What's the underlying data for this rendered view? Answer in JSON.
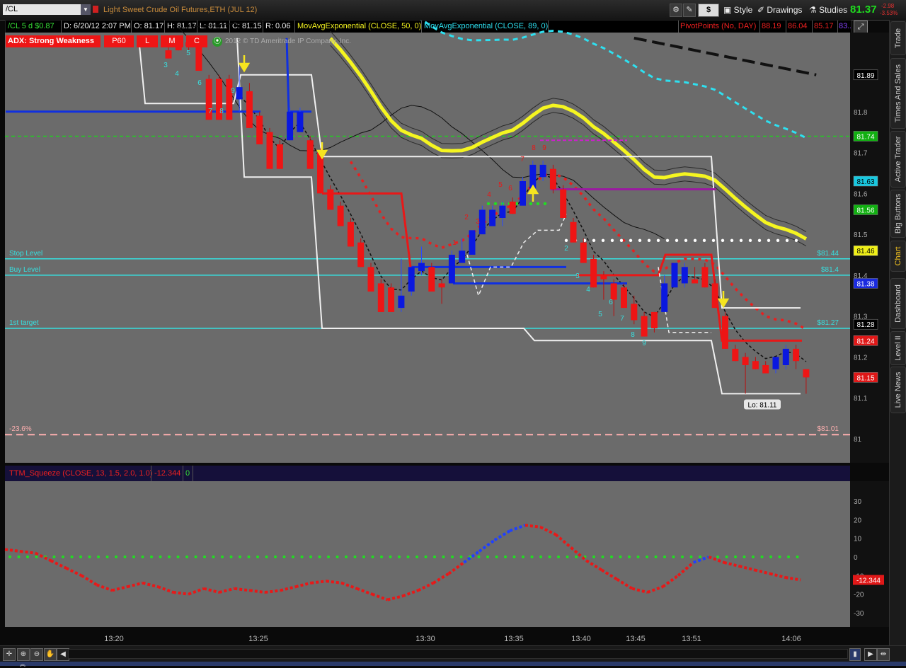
{
  "toolbar": {
    "symbol": "/CL",
    "title": "Light Sweet Crude Oil Futures,ETH (JUL 12)",
    "style_label": "Style",
    "drawings_label": "Drawings",
    "studies_label": "Studies",
    "dollar_label": "$",
    "last_price": "81.37",
    "change": "-2.98",
    "change_pct": "-3.53%"
  },
  "header": {
    "period": "/CL 5 d $0.87",
    "date": "D: 6/20/12 2:07 PM",
    "open": "O: 81.17",
    "high": "H: 81.17",
    "low": "L: 81.11",
    "close": "C: 81.15",
    "range": "R: 0.06",
    "ma50": "MovAvgExponential (CLOSE, 50, 0)",
    "ma89": "MovAvgExponential (CLOSE, 89, 0)",
    "pivot_label": "PivotPoints (No, DAY)",
    "pivot_values": [
      "88.19",
      "86.04",
      "85.17",
      "83..."
    ]
  },
  "badges": {
    "adx": "ADX:  Strong Weakness",
    "p60": "P60",
    "l": "L",
    "m": "M",
    "c": "C",
    "copyright": "2012 © TD Ameritrade IP Company, Inc."
  },
  "sidebar": {
    "tabs": [
      "Trade",
      "Times And Sales",
      "Active Trader",
      "Big Buttons",
      "Chart",
      "Dashboard",
      "Level II",
      "Live News"
    ],
    "active": "Chart"
  },
  "colors": {
    "up": "#0a18e0",
    "down": "#ee1515",
    "panel": "#6b6b6b",
    "ema50": "#f5f520",
    "ema89": "#2ee0f0",
    "level": "#36e0e0"
  },
  "chart_data": [
    {
      "type": "candlestick",
      "title": "",
      "ylim": [
        80.95,
        81.98
      ],
      "y_ticks": [
        81.0,
        81.1,
        81.2,
        81.3,
        81.4,
        81.5,
        81.6,
        81.7,
        81.8
      ],
      "x_ticks": [
        "13:20",
        "13:25",
        "13:30",
        "13:35",
        "13:40",
        "13:45",
        "13:51",
        "14:06"
      ],
      "y_tick_labels": [
        "81",
        "81.1",
        "81.2",
        "81.3",
        "81.4",
        "81.5",
        "81.6",
        "81.7",
        "81.8",
        "81.9"
      ],
      "candles": [
        {
          "o": 81.95,
          "h": 81.96,
          "l": 81.93,
          "c": 81.93
        },
        {
          "o": 81.96,
          "h": 81.97,
          "l": 81.95,
          "c": 81.95
        },
        {
          "o": 81.97,
          "h": 81.98,
          "l": 81.95,
          "c": 81.96
        },
        {
          "o": 81.97,
          "h": 81.98,
          "l": 81.9,
          "c": 81.9
        },
        {
          "o": 81.88,
          "h": 81.89,
          "l": 81.78,
          "c": 81.78
        },
        {
          "o": 81.88,
          "h": 81.89,
          "l": 81.78,
          "c": 81.78
        },
        {
          "o": 81.88,
          "h": 81.89,
          "l": 81.78,
          "c": 81.78
        },
        {
          "o": 81.83,
          "h": 81.91,
          "l": 81.8,
          "c": 81.86
        },
        {
          "o": 81.85,
          "h": 81.87,
          "l": 81.76,
          "c": 81.76
        },
        {
          "o": 81.79,
          "h": 81.8,
          "l": 81.72,
          "c": 81.72
        },
        {
          "o": 81.75,
          "h": 81.76,
          "l": 81.66,
          "c": 81.66
        },
        {
          "o": 81.72,
          "h": 81.73,
          "l": 81.66,
          "c": 81.66
        },
        {
          "o": 81.73,
          "h": 81.81,
          "l": 81.73,
          "c": 81.8
        },
        {
          "o": 81.75,
          "h": 81.81,
          "l": 81.75,
          "c": 81.8
        },
        {
          "o": 81.73,
          "h": 81.74,
          "l": 81.66,
          "c": 81.66
        },
        {
          "o": 81.7,
          "h": 81.71,
          "l": 81.6,
          "c": 81.6
        },
        {
          "o": 81.61,
          "h": 81.62,
          "l": 81.56,
          "c": 81.56
        },
        {
          "o": 81.57,
          "h": 81.58,
          "l": 81.52,
          "c": 81.52
        },
        {
          "o": 81.53,
          "h": 81.54,
          "l": 81.47,
          "c": 81.47
        },
        {
          "o": 81.48,
          "h": 81.49,
          "l": 81.42,
          "c": 81.42
        },
        {
          "o": 81.42,
          "h": 81.43,
          "l": 81.36,
          "c": 81.36
        },
        {
          "o": 81.38,
          "h": 81.39,
          "l": 81.31,
          "c": 81.31
        },
        {
          "o": 81.37,
          "h": 81.38,
          "l": 81.31,
          "c": 81.31
        },
        {
          "o": 81.32,
          "h": 81.44,
          "l": 81.31,
          "c": 81.35
        },
        {
          "o": 81.36,
          "h": 81.42,
          "l": 81.35,
          "c": 81.42
        },
        {
          "o": 81.41,
          "h": 81.47,
          "l": 81.4,
          "c": 81.43
        },
        {
          "o": 81.42,
          "h": 81.43,
          "l": 81.36,
          "c": 81.36
        },
        {
          "o": 81.38,
          "h": 81.39,
          "l": 81.33,
          "c": 81.37
        },
        {
          "o": 81.38,
          "h": 81.46,
          "l": 81.38,
          "c": 81.45
        },
        {
          "o": 81.43,
          "h": 81.49,
          "l": 81.43,
          "c": 81.46
        },
        {
          "o": 81.45,
          "h": 81.51,
          "l": 81.45,
          "c": 81.51
        },
        {
          "o": 81.5,
          "h": 81.57,
          "l": 81.5,
          "c": 81.56
        },
        {
          "o": 81.52,
          "h": 81.57,
          "l": 81.52,
          "c": 81.56
        },
        {
          "o": 81.54,
          "h": 81.58,
          "l": 81.52,
          "c": 81.57
        },
        {
          "o": 81.58,
          "h": 81.59,
          "l": 81.55,
          "c": 81.55
        },
        {
          "o": 81.57,
          "h": 81.64,
          "l": 81.57,
          "c": 81.63
        },
        {
          "o": 81.61,
          "h": 81.68,
          "l": 81.6,
          "c": 81.67
        },
        {
          "o": 81.64,
          "h": 81.68,
          "l": 81.63,
          "c": 81.67
        },
        {
          "o": 81.66,
          "h": 81.67,
          "l": 81.6,
          "c": 81.61
        },
        {
          "o": 81.61,
          "h": 81.62,
          "l": 81.54,
          "c": 81.54
        },
        {
          "o": 81.53,
          "h": 81.54,
          "l": 81.48,
          "c": 81.48
        },
        {
          "o": 81.48,
          "h": 81.49,
          "l": 81.43,
          "c": 81.43
        },
        {
          "o": 81.44,
          "h": 81.45,
          "l": 81.37,
          "c": 81.37
        },
        {
          "o": 81.4,
          "h": 81.41,
          "l": 81.34,
          "c": 81.39
        },
        {
          "o": 81.38,
          "h": 81.39,
          "l": 81.3,
          "c": 81.34
        },
        {
          "o": 81.37,
          "h": 81.38,
          "l": 81.32,
          "c": 81.32
        },
        {
          "o": 81.33,
          "h": 81.35,
          "l": 81.28,
          "c": 81.29
        },
        {
          "o": 81.3,
          "h": 81.31,
          "l": 81.25,
          "c": 81.25
        },
        {
          "o": 81.31,
          "h": 81.31,
          "l": 81.26,
          "c": 81.27
        },
        {
          "o": 81.31,
          "h": 81.4,
          "l": 81.31,
          "c": 81.38
        },
        {
          "o": 81.37,
          "h": 81.43,
          "l": 81.37,
          "c": 81.43
        },
        {
          "o": 81.38,
          "h": 81.43,
          "l": 81.37,
          "c": 81.42
        },
        {
          "o": 81.39,
          "h": 81.42,
          "l": 81.38,
          "c": 81.38
        },
        {
          "o": 81.42,
          "h": 81.43,
          "l": 81.37,
          "c": 81.37
        },
        {
          "o": 81.38,
          "h": 81.39,
          "l": 81.32,
          "c": 81.32
        },
        {
          "o": 81.3,
          "h": 81.31,
          "l": 81.22,
          "c": 81.22
        },
        {
          "o": 81.22,
          "h": 81.23,
          "l": 81.19,
          "c": 81.19
        },
        {
          "o": 81.2,
          "h": 81.21,
          "l": 81.11,
          "c": 81.18
        },
        {
          "o": 81.19,
          "h": 81.2,
          "l": 81.17,
          "c": 81.17
        },
        {
          "o": 81.18,
          "h": 81.19,
          "l": 81.16,
          "c": 81.16
        },
        {
          "o": 81.17,
          "h": 81.2,
          "l": 81.16,
          "c": 81.2
        },
        {
          "o": 81.18,
          "h": 81.23,
          "l": 81.17,
          "c": 81.22
        },
        {
          "o": 81.22,
          "h": 81.23,
          "l": 81.17,
          "c": 81.19
        },
        {
          "o": 81.17,
          "h": 81.17,
          "l": 81.11,
          "c": 81.15
        }
      ],
      "levels": [
        {
          "label": "Stop Level",
          "value": 81.44,
          "value_label": "$81.44",
          "color": "#36e0e0"
        },
        {
          "label": "Buy Level",
          "value": 81.4,
          "value_label": "$81.4",
          "color": "#36e0e0"
        },
        {
          "label": "1st target",
          "value": 81.27,
          "value_label": "$81.27",
          "color": "#36e0e0"
        },
        {
          "label": "-23.6%",
          "value": 81.01,
          "value_label": "$81.01",
          "color": "#ffb0b0"
        }
      ],
      "price_badges": [
        {
          "value": 81.89,
          "label": "81.89",
          "bg": "#000000",
          "fg": "#ffffff"
        },
        {
          "value": 81.74,
          "label": "81.74",
          "bg": "#11b011",
          "fg": "#ffffff"
        },
        {
          "value": 81.63,
          "label": "81.63",
          "bg": "#18c8e0",
          "fg": "#000000"
        },
        {
          "value": 81.56,
          "label": "81.56",
          "bg": "#11b011",
          "fg": "#ffffff"
        },
        {
          "value": 81.46,
          "label": "81.46",
          "bg": "#f0f018",
          "fg": "#000000"
        },
        {
          "value": 81.38,
          "label": "81.38",
          "bg": "#1a2ae0",
          "fg": "#ffffff"
        },
        {
          "value": 81.28,
          "label": "81.28",
          "bg": "#000000",
          "fg": "#ffffff"
        },
        {
          "value": 81.24,
          "label": "81.24",
          "bg": "#e01818",
          "fg": "#ffffff"
        },
        {
          "value": 81.15,
          "label": "81.15",
          "bg": "#e01818",
          "fg": "#ffffff"
        }
      ],
      "low_label": "Lo: 81.11",
      "count_labels": [
        "3",
        "4",
        "5",
        "6",
        "7",
        "8",
        "9",
        "1",
        "2",
        "3",
        "4",
        "5",
        "6",
        "7",
        "8",
        "9",
        "2",
        "3",
        "4",
        "5",
        "6",
        "7",
        "8",
        "9"
      ]
    },
    {
      "type": "line",
      "title": "TTM_Squeeze (CLOSE, 13, 1.5, 2.0, 1.0)",
      "value_label": "-12.344",
      "extra_label": "0",
      "ylim": [
        -35,
        35
      ],
      "y_ticks": [
        -30,
        -20,
        -10,
        0,
        10,
        20,
        30
      ],
      "y_tick_labels": [
        "-30",
        "-20",
        "-10",
        "0",
        "10",
        "20",
        "30"
      ],
      "current": -12.344,
      "momentum": [
        4,
        3,
        2,
        -2,
        -6,
        -10,
        -15,
        -18,
        -16,
        -14,
        -16,
        -19,
        -20,
        -17,
        -19,
        -17,
        -18,
        -19,
        -18,
        -16,
        -14,
        -13,
        -14,
        -17,
        -20,
        -23,
        -21,
        -18,
        -14,
        -9,
        -3,
        3,
        9,
        14,
        17,
        16,
        12,
        5,
        -2,
        -7,
        -12,
        -17,
        -19,
        -16,
        -10,
        -3,
        0,
        -3,
        -5,
        -7,
        -9,
        -11,
        -12.344
      ]
    }
  ]
}
